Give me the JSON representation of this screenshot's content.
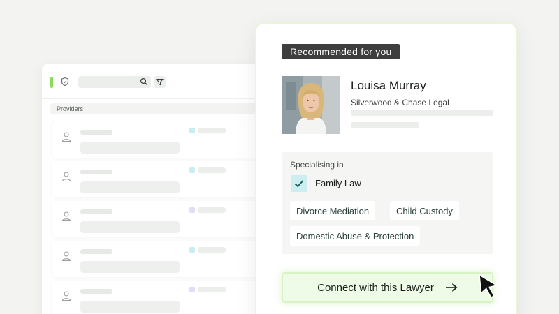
{
  "providers_panel": {
    "header_label": "Providers",
    "rows": [
      {
        "tag_color": "#c8eef0"
      },
      {
        "tag_color": "#c8eef0"
      },
      {
        "tag_color": "#e2dcf5"
      },
      {
        "tag_color": "#c8eef0"
      },
      {
        "tag_color": "#e2dcf5"
      }
    ]
  },
  "recommendation": {
    "badge": "Recommended for you",
    "lawyer": {
      "name": "Louisa Murray",
      "firm": "Silverwood & Chase Legal"
    },
    "specialising": {
      "heading": "Specialising in",
      "primary": "Family Law",
      "chips": [
        "Divorce Mediation",
        "Child Custody",
        "Domestic Abuse & Protection"
      ]
    },
    "connect_button": "Connect with this Lawyer"
  },
  "colors": {
    "accent_green": "#8cdc5a",
    "badge_bg": "#3d3e3d",
    "check_bg": "#cdeef0",
    "button_bg": "#eefbe6"
  },
  "icons": [
    "shield-icon",
    "search-icon",
    "filter-icon",
    "person-icon",
    "check-icon",
    "arrow-right-icon",
    "cursor-icon"
  ]
}
